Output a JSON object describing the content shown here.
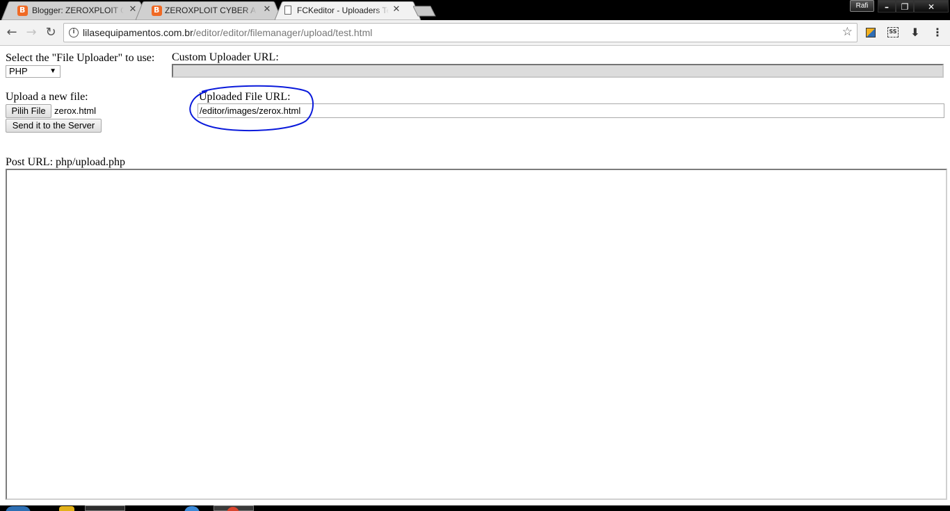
{
  "browser": {
    "tabs": [
      {
        "title": "Blogger: ZEROXPLOIT CY",
        "icon": "blogger-icon",
        "active": false
      },
      {
        "title": "ZEROXPLOIT CYBER ARM",
        "icon": "blogger-icon",
        "active": false
      },
      {
        "title": "FCKeditor - Uploaders Te",
        "icon": "document-icon",
        "active": true
      }
    ],
    "profile_name": "Rafi",
    "url_host": "lilasequipamentos.com.br",
    "url_path": "/editor/editor/filemanager/upload/test.html"
  },
  "page": {
    "select_label": "Select the \"File Uploader\" to use:",
    "selected_uploader": "PHP",
    "custom_url_label": "Custom Uploader URL:",
    "upload_label": "Upload a new file:",
    "choose_file_label": "Pilih File",
    "chosen_file": "zerox.html",
    "send_label": "Send it to the Server",
    "uploaded_url_label": "Uploaded File URL:",
    "uploaded_url_value": "/editor/images/zerox.html",
    "post_url_label": "Post URL: php/upload.php"
  },
  "colors": {
    "highlight_circle": "#0a1adb",
    "blogger_orange": "#f06a25"
  }
}
